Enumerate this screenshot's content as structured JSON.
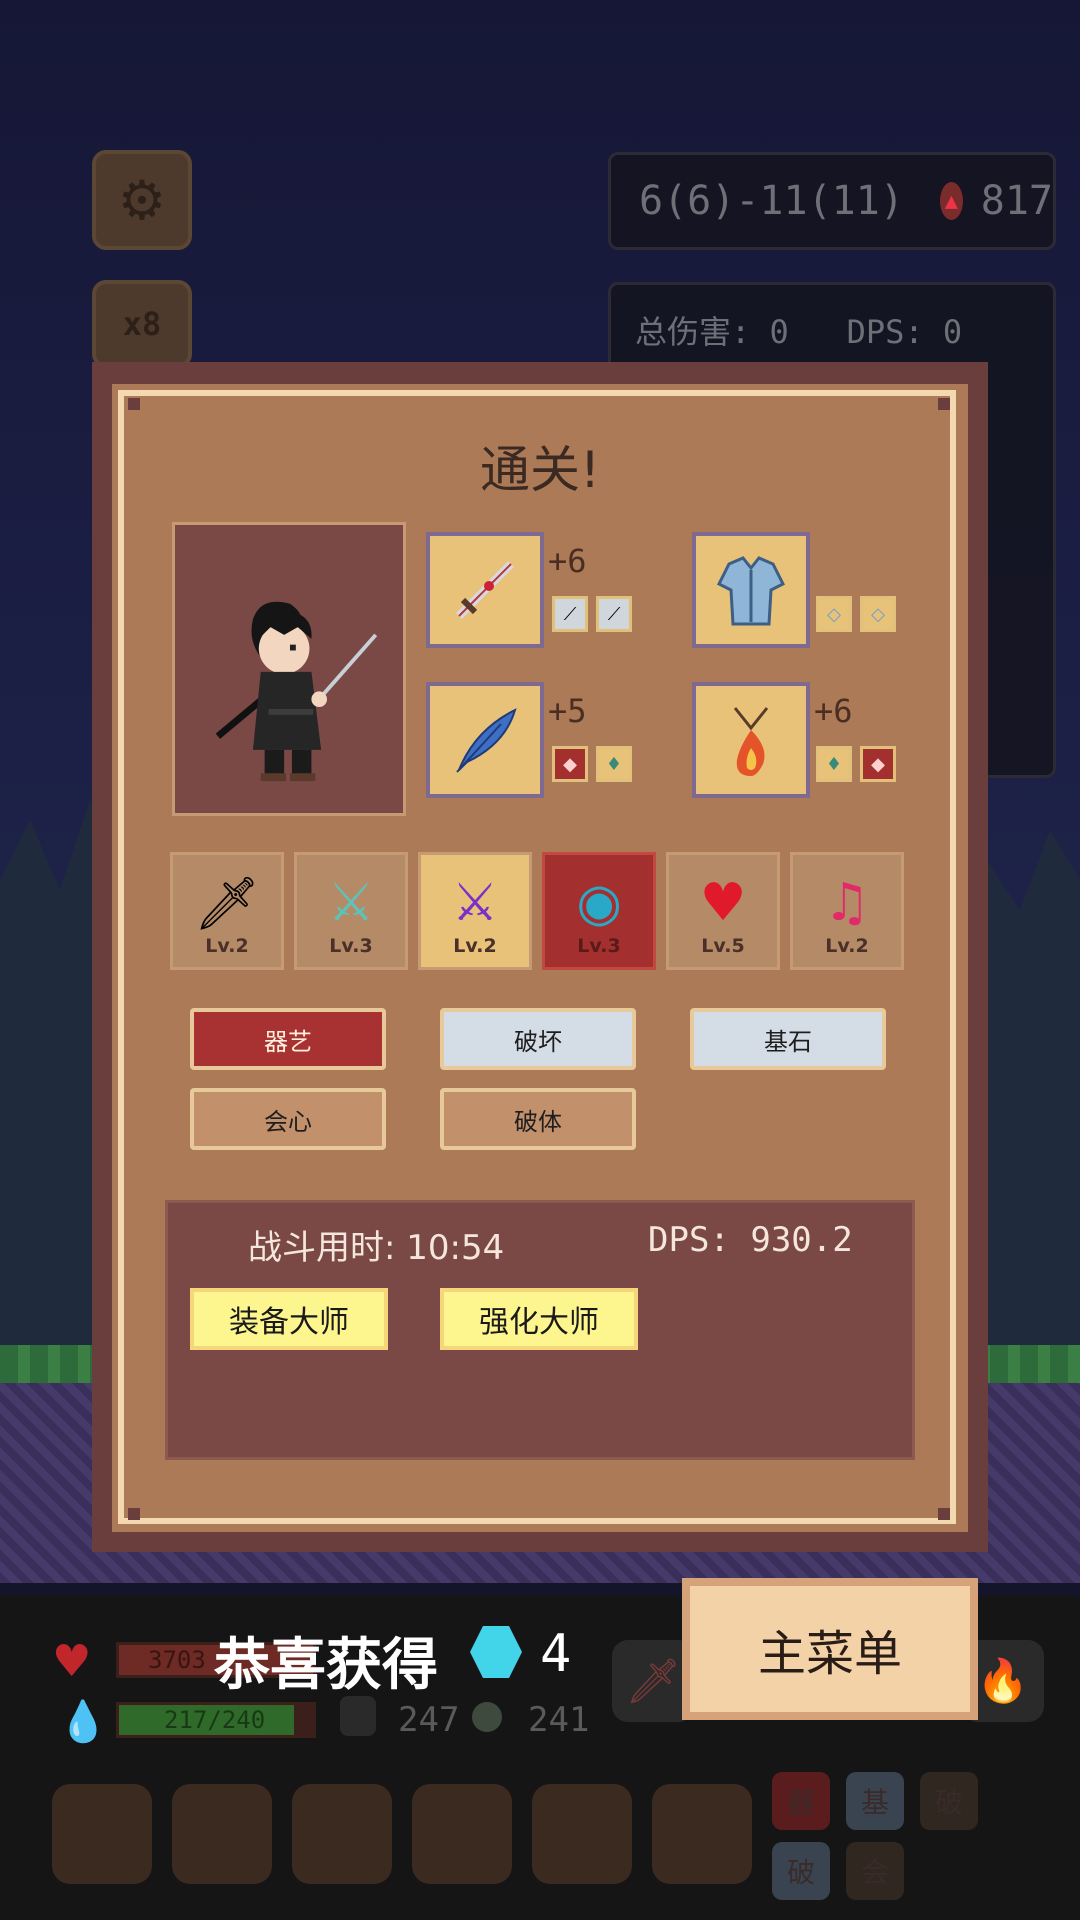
{
  "hud": {
    "stage": "6(6)-11(11)",
    "fire_count": "817",
    "speed": "x8",
    "total_damage": "总伤害: 0   DPS: 0"
  },
  "panel": {
    "title": "通关!",
    "equipment": [
      {
        "name": "sword",
        "plus": "+6",
        "gems": [
          "feather-gem",
          "feather-gem"
        ]
      },
      {
        "name": "armor",
        "plus": "",
        "gems": [
          "diamond-gem",
          "diamond-gem"
        ]
      },
      {
        "name": "feather",
        "plus": "+5",
        "gems": [
          "red-gem",
          "crystal-gem"
        ]
      },
      {
        "name": "fire-amulet",
        "plus": "+6",
        "gems": [
          "crystal-gem",
          "red-gem"
        ]
      }
    ],
    "skills": [
      {
        "icon": "sword-icon",
        "level": "Lv.2",
        "highlight": "none"
      },
      {
        "icon": "magic-sword-icon",
        "level": "Lv.3",
        "highlight": "none"
      },
      {
        "icon": "purple-sword-icon",
        "level": "Lv.2",
        "highlight": "gold"
      },
      {
        "icon": "vortex-icon",
        "level": "Lv.3",
        "highlight": "red"
      },
      {
        "icon": "heart-dagger-icon",
        "level": "Lv.5",
        "highlight": "none"
      },
      {
        "icon": "music-icon",
        "level": "Lv.2",
        "highlight": "none"
      }
    ],
    "tags": [
      {
        "label": "器艺",
        "color": "#a83232"
      },
      {
        "label": "破坏",
        "color": "#d4dde6"
      },
      {
        "label": "基石",
        "color": "#d4dde6"
      },
      {
        "label": "会心",
        "color": "#c2916c"
      },
      {
        "label": "破体",
        "color": "#c2916c"
      }
    ],
    "battle_time_label": "战斗用时: 10:54",
    "dps_label": "DPS: 930.2",
    "achievements": [
      "装备大师",
      "强化大师"
    ]
  },
  "bottom": {
    "hp": "3703",
    "mp": "217/240",
    "armor_value": "247",
    "orb_value": "241",
    "reward_text": "恭喜获得",
    "reward_count": "4",
    "menu_button": "主菜单",
    "mini_tags": [
      "器",
      "基",
      "破",
      "破",
      "会"
    ]
  }
}
